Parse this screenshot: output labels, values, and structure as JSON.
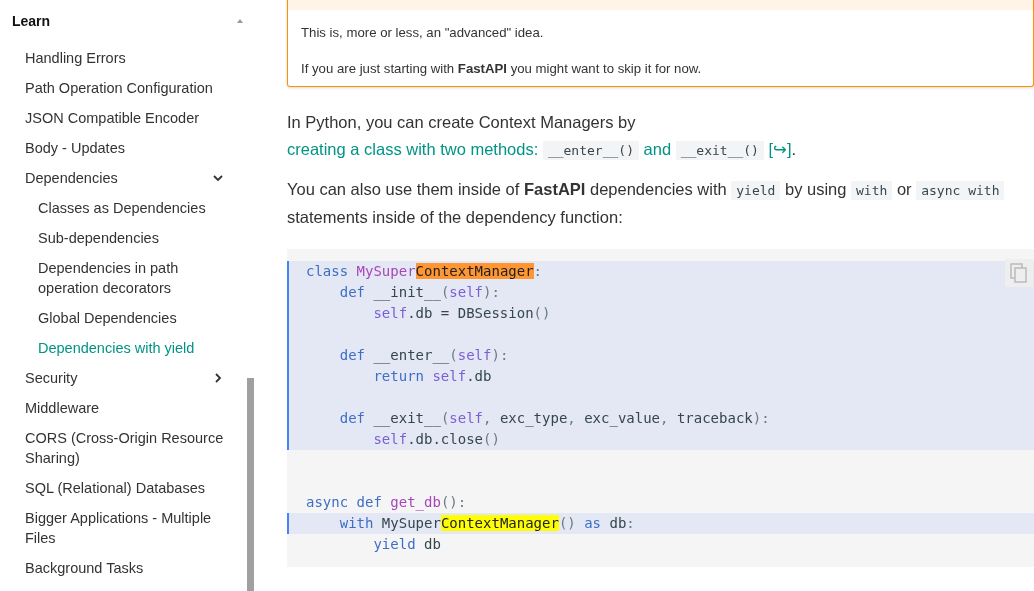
{
  "sidebar": {
    "title": "Learn",
    "items": [
      {
        "label": "Handling Errors",
        "selected": false
      },
      {
        "label": "Path Operation Configuration",
        "selected": false
      },
      {
        "label": "JSON Compatible Encoder",
        "selected": false
      },
      {
        "label": "Body - Updates",
        "selected": false
      },
      {
        "label": "Dependencies",
        "selected": false,
        "expanded": true,
        "children": [
          {
            "label": "Classes as Dependencies",
            "selected": false
          },
          {
            "label": "Sub-dependencies",
            "selected": false
          },
          {
            "label": "Dependencies in path operation decorators",
            "selected": false
          },
          {
            "label": "Global Dependencies",
            "selected": false
          },
          {
            "label": "Dependencies with yield",
            "selected": true
          }
        ]
      },
      {
        "label": "Security",
        "selected": false,
        "expanded": false
      },
      {
        "label": "Middleware",
        "selected": false
      },
      {
        "label": "CORS (Cross-Origin Resource Sharing)",
        "selected": false
      },
      {
        "label": "SQL (Relational) Databases",
        "selected": false
      },
      {
        "label": "Bigger Applications - Multiple Files",
        "selected": false
      },
      {
        "label": "Background Tasks",
        "selected": false
      }
    ]
  },
  "admonition": {
    "paragraphs": [
      "This is, more or less, an \"advanced\" idea.",
      "If you are just starting with **FastAPI** you might want to skip it for now."
    ]
  },
  "paragraphs": [
    {
      "segments": [
        {
          "kind": "text",
          "text": "In Python, you can create Context Managers by "
        },
        {
          "kind": "link",
          "parts": [
            {
              "kind": "text",
              "text": "creating a class with two methods: "
            },
            {
              "kind": "code",
              "text": "__enter__()"
            },
            {
              "kind": "text",
              "text": " and "
            },
            {
              "kind": "code",
              "text": "__exit__()"
            },
            {
              "kind": "text",
              "text": " [↪]"
            }
          ]
        },
        {
          "kind": "text",
          "text": "."
        }
      ]
    },
    {
      "segments": [
        {
          "kind": "text",
          "text": "You can also use them inside of "
        },
        {
          "kind": "bold",
          "text": "FastAPI"
        },
        {
          "kind": "text",
          "text": " dependencies with "
        },
        {
          "kind": "code",
          "text": "yield"
        },
        {
          "kind": "text",
          "text": " by using "
        },
        {
          "kind": "code",
          "text": "with"
        },
        {
          "kind": "text",
          "text": " or "
        },
        {
          "kind": "code",
          "text": "async with"
        },
        {
          "kind": "text",
          "text": " statements inside of the dependency function:"
        }
      ]
    }
  ],
  "code": {
    "blocks": [
      {
        "highlighted": true,
        "lines": [
          {
            "kind": "code",
            "tokens": [
              {
                "kind": "kw",
                "text": "class "
              },
              {
                "kind": "name",
                "text": "MySuper"
              },
              {
                "kind": "mark_orange",
                "text": "ContextManager"
              },
              {
                "kind": "punct",
                "text": ":"
              }
            ]
          },
          {
            "kind": "code",
            "tokens": [
              {
                "kind": "kw",
                "text": "    def "
              },
              {
                "kind": "plain",
                "text": "__init__"
              },
              {
                "kind": "punct",
                "text": "("
              },
              {
                "kind": "self",
                "text": "self"
              },
              {
                "kind": "punct",
                "text": "):"
              }
            ]
          },
          {
            "kind": "code",
            "tokens": [
              {
                "kind": "self",
                "text": "        self"
              },
              {
                "kind": "plain",
                "text": ".db = DBSession"
              },
              {
                "kind": "punct",
                "text": "()"
              }
            ]
          },
          {
            "kind": "blank"
          },
          {
            "kind": "code",
            "tokens": [
              {
                "kind": "kw",
                "text": "    def "
              },
              {
                "kind": "plain",
                "text": "__enter__"
              },
              {
                "kind": "punct",
                "text": "("
              },
              {
                "kind": "self",
                "text": "self"
              },
              {
                "kind": "punct",
                "text": "):"
              }
            ]
          },
          {
            "kind": "code",
            "tokens": [
              {
                "kind": "kw",
                "text": "        return "
              },
              {
                "kind": "self",
                "text": "self"
              },
              {
                "kind": "plain",
                "text": ".db"
              }
            ]
          },
          {
            "kind": "blank"
          },
          {
            "kind": "code",
            "tokens": [
              {
                "kind": "kw",
                "text": "    def "
              },
              {
                "kind": "plain",
                "text": "__exit__"
              },
              {
                "kind": "punct",
                "text": "("
              },
              {
                "kind": "self",
                "text": "self"
              },
              {
                "kind": "punct",
                "text": ", "
              },
              {
                "kind": "plain",
                "text": "exc_type"
              },
              {
                "kind": "punct",
                "text": ", "
              },
              {
                "kind": "plain",
                "text": "exc_value"
              },
              {
                "kind": "punct",
                "text": ", "
              },
              {
                "kind": "plain",
                "text": "traceback"
              },
              {
                "kind": "punct",
                "text": "):"
              }
            ]
          },
          {
            "kind": "code",
            "tokens": [
              {
                "kind": "self",
                "text": "        self"
              },
              {
                "kind": "plain",
                "text": ".db.close"
              },
              {
                "kind": "punct",
                "text": "()"
              }
            ]
          }
        ]
      },
      {
        "highlighted": false,
        "lines": [
          {
            "kind": "blank"
          },
          {
            "kind": "blank"
          },
          {
            "kind": "code",
            "tokens": [
              {
                "kind": "kw",
                "text": "async def "
              },
              {
                "kind": "name",
                "text": "get_db"
              },
              {
                "kind": "punct",
                "text": "():"
              }
            ]
          }
        ]
      },
      {
        "highlighted": true,
        "lines": [
          {
            "kind": "code",
            "tokens": [
              {
                "kind": "kw",
                "text": "    with "
              },
              {
                "kind": "plain",
                "text": "MySuper"
              },
              {
                "kind": "mark_yellow",
                "text": "ContextManager"
              },
              {
                "kind": "punct",
                "text": "() "
              },
              {
                "kind": "kw",
                "text": "as "
              },
              {
                "kind": "plain",
                "text": "db"
              },
              {
                "kind": "punct",
                "text": ":"
              }
            ]
          }
        ]
      },
      {
        "highlighted": false,
        "lines": [
          {
            "kind": "code",
            "tokens": [
              {
                "kind": "kw",
                "text": "        yield "
              },
              {
                "kind": "plain",
                "text": "db"
              }
            ]
          }
        ]
      }
    ]
  }
}
